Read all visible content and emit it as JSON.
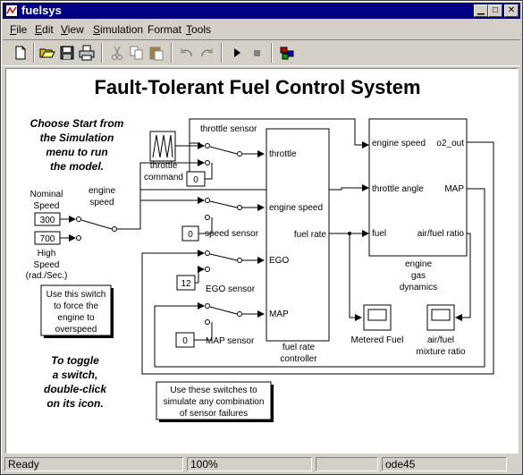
{
  "window": {
    "title": "fuelsys"
  },
  "menu": [
    {
      "label": "File",
      "u": "F",
      "rest": "ile"
    },
    {
      "label": "Edit",
      "u": "E",
      "rest": "dit"
    },
    {
      "label": "View",
      "u": "V",
      "rest": "iew"
    },
    {
      "label": "Simulation",
      "u": "S",
      "rest": "imulation"
    },
    {
      "label": "Format",
      "u": "",
      "rest": "Format"
    },
    {
      "label": "Tools",
      "u": "T",
      "rest": "ools"
    }
  ],
  "toolbar_icons": [
    "new-model-icon",
    "open-icon",
    "save-icon",
    "print-icon",
    "cut-icon",
    "copy-icon",
    "paste-icon",
    "undo-icon",
    "redo-icon",
    "start-simulation-icon",
    "stop-simulation-icon",
    "library-browser-icon"
  ],
  "diagram": {
    "title": "Fault-Tolerant Fuel Control System",
    "instructions_start": [
      "Choose Start from",
      "the Simulation",
      "menu to run",
      "the model."
    ],
    "instructions_toggle": [
      "To toggle",
      "a switch,",
      "double-click",
      "on its icon."
    ],
    "note_overspeed": [
      "Use this switch",
      "to force the",
      "engine to",
      "overspeed"
    ],
    "note_sensors": [
      "Use these switches to",
      "simulate any combination",
      "of sensor failures"
    ],
    "nominal_speed_label": [
      "Nominal",
      "Speed"
    ],
    "high_speed_label": [
      "High",
      "Speed",
      "(rad./Sec.)"
    ],
    "engine_speed_label": [
      "engine",
      "speed"
    ],
    "const_nominal": "300",
    "const_high": "700",
    "const_throttle": "0",
    "const_speed": "0",
    "const_ego": "12",
    "const_map": "0",
    "throttle_sensor_label": "throttle sensor",
    "speed_sensor_label": "speed sensor",
    "ego_sensor_label": "EGO sensor",
    "map_sensor_label": "MAP sensor",
    "throttle_command_label": [
      "throttle",
      "command"
    ],
    "frc": {
      "in_throttle": "throttle",
      "in_engine_speed": "engine speed",
      "in_ego": "EGO",
      "in_map": "MAP",
      "out_fuel_rate": "fuel rate",
      "label": [
        "fuel rate",
        "controller"
      ]
    },
    "egd": {
      "in_engine_speed": "engine speed",
      "in_throttle_angle": "throttle angle",
      "in_fuel": "fuel",
      "out_o2": "o2_out",
      "out_map": "MAP",
      "out_afr": "air/fuel ratio",
      "label": [
        "engine",
        "gas",
        "dynamics"
      ]
    },
    "scope_fuel_label": "Metered Fuel",
    "scope_afr_label": [
      "air/fuel",
      "mixture ratio"
    ]
  },
  "status": {
    "ready": "Ready",
    "zoom": "100%",
    "solver": "ode45"
  },
  "colors": {
    "titlebar": "#000080",
    "window_face": "#d4d0c8",
    "canvas": "#ffffff"
  }
}
